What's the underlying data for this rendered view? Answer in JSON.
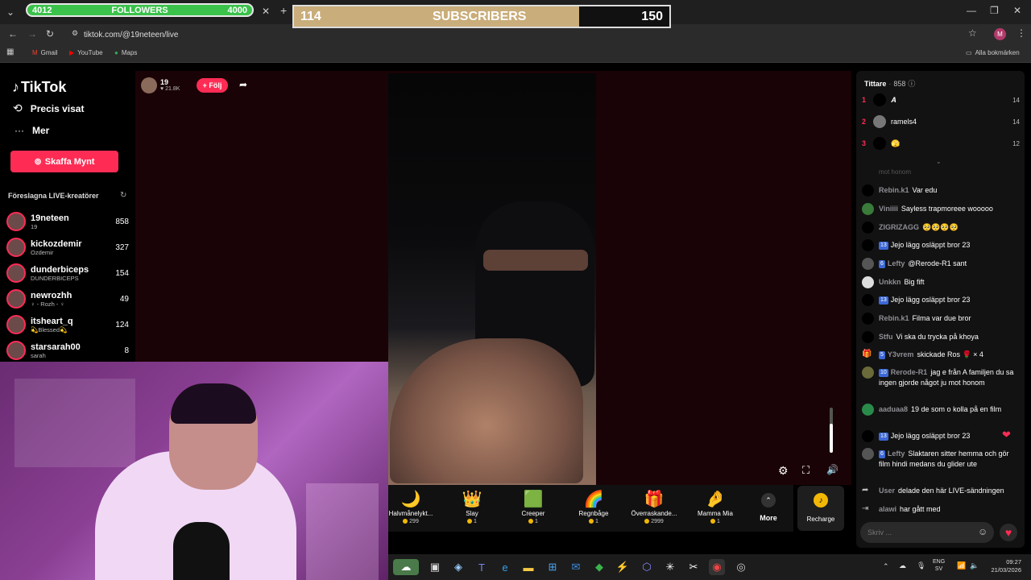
{
  "overlay": {
    "followers": {
      "current": "4012",
      "label": "FOLLOWERS",
      "goal": "4000",
      "progress": 1.0
    },
    "subscribers": {
      "current": "114",
      "label": "SUBSCRIBERS",
      "goal": "150",
      "progress": 0.76
    }
  },
  "browser": {
    "url": "tiktok.com/@19neteen/live",
    "bookmarks": [
      "Gmail",
      "YouTube",
      "Maps"
    ],
    "all_bookmarks": "Alla bokmärken",
    "profile_initial": "M"
  },
  "sidebar": {
    "logo": "TikTok",
    "items": [
      {
        "label": "Precis visat"
      },
      {
        "label": "Mer"
      }
    ],
    "coins_button": "Skaffa Mynt",
    "suggested_title": "Föreslagna LIVE-kreatörer",
    "creators": [
      {
        "name": "19neteen",
        "sub": "19",
        "count": "858"
      },
      {
        "name": "kickozdemir",
        "sub": "Ozdemir",
        "count": "327"
      },
      {
        "name": "dunderbiceps",
        "sub": "DUNDERBICEPS",
        "count": "154"
      },
      {
        "name": "newrozhh",
        "sub": "♀ - Rozh - ♀",
        "count": "49"
      },
      {
        "name": "itsheart_q",
        "sub": "💫Blessed💫",
        "count": "124"
      },
      {
        "name": "starsarah00",
        "sub": "sarah",
        "count": "8"
      }
    ]
  },
  "stream": {
    "host_name": "19",
    "host_likes": "21.8K",
    "follow_label": "+ Följ"
  },
  "gifts": [
    {
      "name": "Halvmånelykt...",
      "price": "299",
      "icon": "🌙"
    },
    {
      "name": "Slay",
      "price": "1",
      "icon": "👑"
    },
    {
      "name": "Creeper",
      "price": "1",
      "icon": "🟩"
    },
    {
      "name": "Regnbåge",
      "price": "1",
      "icon": "🌈"
    },
    {
      "name": "Överraskande...",
      "price": "2999",
      "icon": "🎁"
    },
    {
      "name": "Mamma Mia",
      "price": "1",
      "icon": "🤌"
    }
  ],
  "gift_more": "More",
  "recharge": "Recharge",
  "chat": {
    "title": "Tittare",
    "viewer_count": "858",
    "top": [
      {
        "rank": "1",
        "name": "𝑨",
        "score": "14"
      },
      {
        "rank": "2",
        "name": "ramels4",
        "score": "14"
      },
      {
        "rank": "3",
        "name": "🫣",
        "score": "12"
      }
    ],
    "fade_text": "mot honom",
    "messages": [
      {
        "user": "Rebin.k1",
        "badge": "",
        "text": "Var edu"
      },
      {
        "user": "Viniiii",
        "badge": "",
        "text": "Sayless trapmoreee wooooo"
      },
      {
        "user": "ZIGRIZAGG",
        "badge": "",
        "text": "🥺🥺🥺🥺"
      },
      {
        "user": "",
        "badge": "13",
        "text": "Jejo lägg osläppt bror 23"
      },
      {
        "user": "Lefty",
        "badge": "6",
        "text": "@Rerode-R1 sant"
      },
      {
        "user": "Unkkn",
        "badge": "",
        "text": "Big fift"
      },
      {
        "user": "",
        "badge": "13",
        "text": "Jejo lägg osläppt bror 23"
      },
      {
        "user": "Rebin.k1",
        "badge": "",
        "text": "Filma var due bror"
      },
      {
        "user": "Stfu",
        "badge": "",
        "text": "Vi ska du trycka på khoya"
      },
      {
        "user": "Y3vrem",
        "badge": "5",
        "text": "skickade Ros 🌹 × 4"
      },
      {
        "user": "Rerode-R1",
        "badge": "10",
        "text": "jag e från A familjen du sa ingen gjorde något ju mot honom"
      },
      {
        "user": "aaduaa8",
        "badge": "",
        "text": "19 de som o kolla på en film"
      },
      {
        "user": "",
        "badge": "13",
        "text": "Jejo lägg osläppt bror 23"
      },
      {
        "user": "Lefty",
        "badge": "6",
        "text": "Slaktaren sitter hemma och gör film hindi medans du glider ute"
      },
      {
        "user": "User",
        "badge": "",
        "text": "delade den här LIVE-sändningen"
      },
      {
        "user": "alawi",
        "badge": "",
        "text": "har gått med"
      }
    ],
    "input_placeholder": "Skriv ..."
  },
  "taskbar": {
    "lang": "ENG",
    "region": "SV",
    "time": "09:27",
    "date": "21/03/2026"
  }
}
